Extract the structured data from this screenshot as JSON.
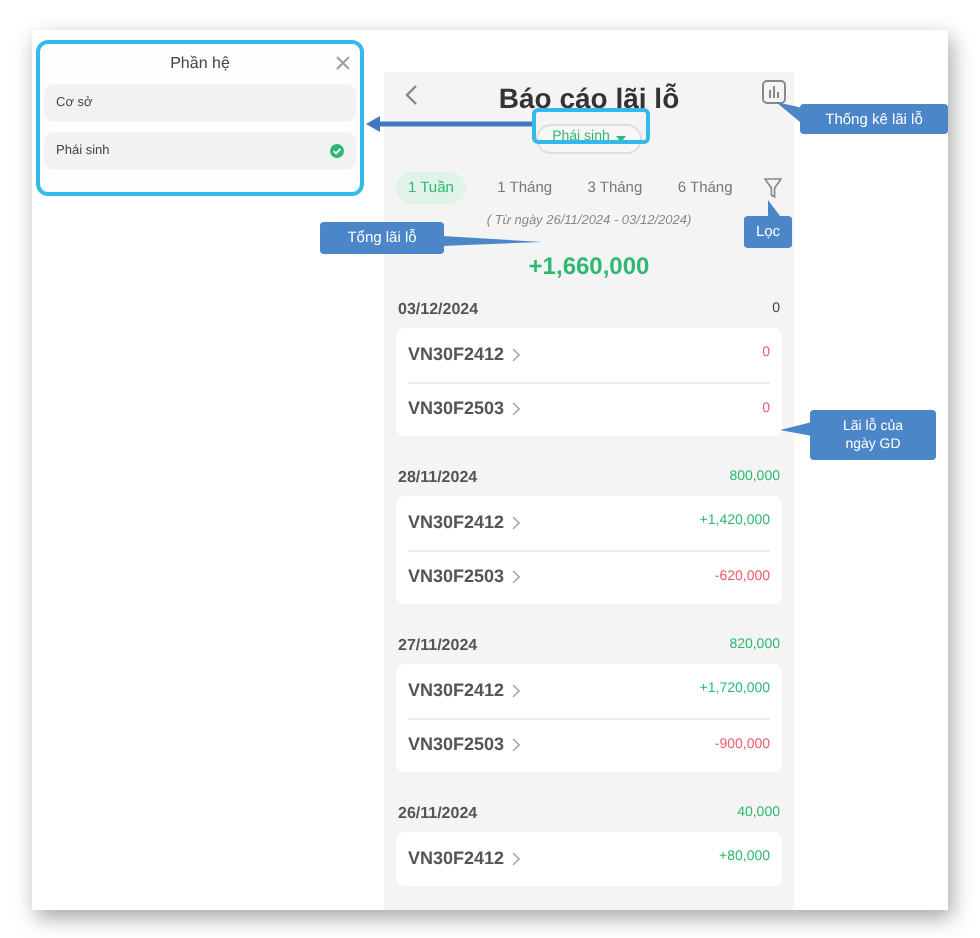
{
  "popup": {
    "title": "Phần hệ",
    "options": [
      {
        "label": "Cơ sở",
        "selected": false
      },
      {
        "label": "Phái sinh",
        "selected": true
      }
    ]
  },
  "header": {
    "title": "Báo cáo lãi lỗ",
    "market": "Phái sinh"
  },
  "tabs": [
    {
      "label": "1 Tuần",
      "selected": true
    },
    {
      "label": "1 Tháng",
      "selected": false
    },
    {
      "label": "3 Tháng",
      "selected": false
    },
    {
      "label": "6 Tháng",
      "selected": false
    }
  ],
  "date_range": "( Từ ngày 26/11/2024 - 03/12/2024)",
  "total": {
    "value": "+1,660,000",
    "color": "#2eb872"
  },
  "days": [
    {
      "date": "03/12/2024",
      "value": "0",
      "color": "#444444",
      "rows": [
        {
          "symbol": "VN30F2412",
          "value": "0",
          "color": "#f05a6a"
        },
        {
          "symbol": "VN30F2503",
          "value": "0",
          "color": "#f05a6a"
        }
      ]
    },
    {
      "date": "28/11/2024",
      "value": "800,000",
      "color": "#2eb872",
      "rows": [
        {
          "symbol": "VN30F2412",
          "value": "+1,420,000",
          "color": "#2eb872"
        },
        {
          "symbol": "VN30F2503",
          "value": "-620,000",
          "color": "#f05a6a"
        }
      ]
    },
    {
      "date": "27/11/2024",
      "value": "820,000",
      "color": "#2eb872",
      "rows": [
        {
          "symbol": "VN30F2412",
          "value": "+1,720,000",
          "color": "#2eb872"
        },
        {
          "symbol": "VN30F2503",
          "value": "-900,000",
          "color": "#f05a6a"
        }
      ]
    },
    {
      "date": "26/11/2024",
      "value": "40,000",
      "color": "#2eb872",
      "rows": [
        {
          "symbol": "VN30F2412",
          "value": "+80,000",
          "color": "#2eb872"
        }
      ]
    }
  ],
  "callouts": [
    "Thống kê lãi lỗ",
    "Lọc",
    "Tổng lãi lỗ",
    "Lãi lỗ của ngày GD"
  ]
}
